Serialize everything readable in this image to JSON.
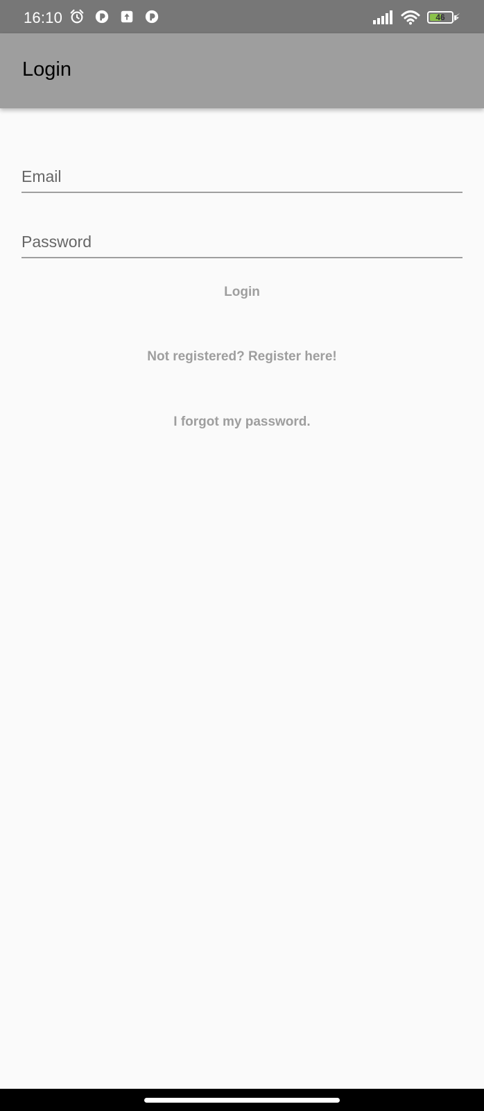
{
  "status_bar": {
    "time": "16:10",
    "left_icons": [
      "alarm-icon",
      "app-notification-icon",
      "upload-icon",
      "app-notification-icon"
    ],
    "right_icons": [
      "signal-icon",
      "wifi-icon",
      "battery-icon",
      "charging-icon"
    ],
    "battery_level": "46",
    "battery_color": "#8bc34a"
  },
  "app_bar": {
    "title": "Login",
    "color": "#9e9e9e"
  },
  "form": {
    "email_placeholder": "Email",
    "email_value": "",
    "password_placeholder": "Password",
    "password_value": ""
  },
  "actions": {
    "login_label": "Login",
    "register_label": "Not registered? Register here!",
    "forgot_label": "I forgot my password."
  }
}
